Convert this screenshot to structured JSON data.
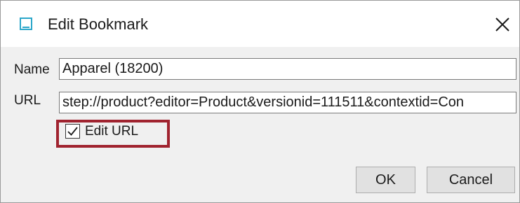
{
  "window": {
    "title": "Edit Bookmark",
    "icon": "bookmark-window-icon",
    "close_icon": "close-icon"
  },
  "form": {
    "name_label": "Name",
    "name_value": "Apparel (18200)",
    "url_label": "URL",
    "url_value": "step://product?editor=Product&versionid=111511&contextid=Con",
    "edit_url_label": "Edit URL",
    "edit_url_checked": true
  },
  "buttons": {
    "ok_label": "OK",
    "cancel_label": "Cancel"
  },
  "colors": {
    "highlight": "#a0232f",
    "icon_accent": "#2aa6c9"
  }
}
